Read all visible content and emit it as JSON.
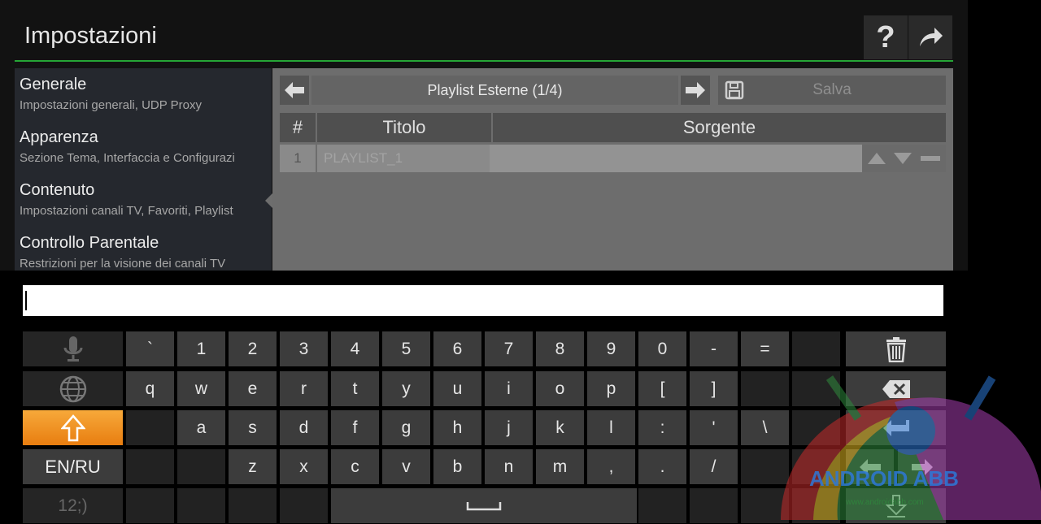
{
  "header": {
    "title": "Impostazioni"
  },
  "sidebar": {
    "items": [
      {
        "title": "Generale",
        "subtitle": "Impostazioni generali, UDP Proxy"
      },
      {
        "title": "Apparenza",
        "subtitle": "Sezione Tema, Interfaccia e Configurazi"
      },
      {
        "title": "Contenuto",
        "subtitle": "Impostazioni canali TV, Favoriti, Playlist"
      },
      {
        "title": "Controllo Parentale",
        "subtitle": "Restrizioni per la visione dei canali TV"
      }
    ]
  },
  "toolbar": {
    "title": "Playlist Esterne (1/4)",
    "save_label": "Salva"
  },
  "table": {
    "headers": [
      "#",
      "Titolo",
      "Sorgente"
    ],
    "rows": [
      {
        "num": "1",
        "title": "PLAYLIST_1",
        "source": ""
      }
    ]
  },
  "keyboard": {
    "input_value": "",
    "rows": [
      [
        "`",
        "1",
        "2",
        "3",
        "4",
        "5",
        "6",
        "7",
        "8",
        "9",
        "0",
        "-",
        "="
      ],
      [
        "q",
        "w",
        "e",
        "r",
        "t",
        "y",
        "u",
        "i",
        "o",
        "p",
        "[",
        "]"
      ],
      [
        "a",
        "s",
        "d",
        "f",
        "g",
        "h",
        "j",
        "k",
        "l",
        ":",
        "'",
        "\\"
      ],
      [
        "z",
        "x",
        "c",
        "v",
        "b",
        "n",
        "m",
        ",",
        ".",
        "/"
      ]
    ],
    "lang_label": "EN/RU",
    "numsym_label": "12;)"
  },
  "watermark": {
    "text": "ANDROID ABB",
    "url": "www.androidabb.com"
  },
  "colors": {
    "accent_green": "#25a536",
    "shift_orange": "#f08a1c"
  }
}
